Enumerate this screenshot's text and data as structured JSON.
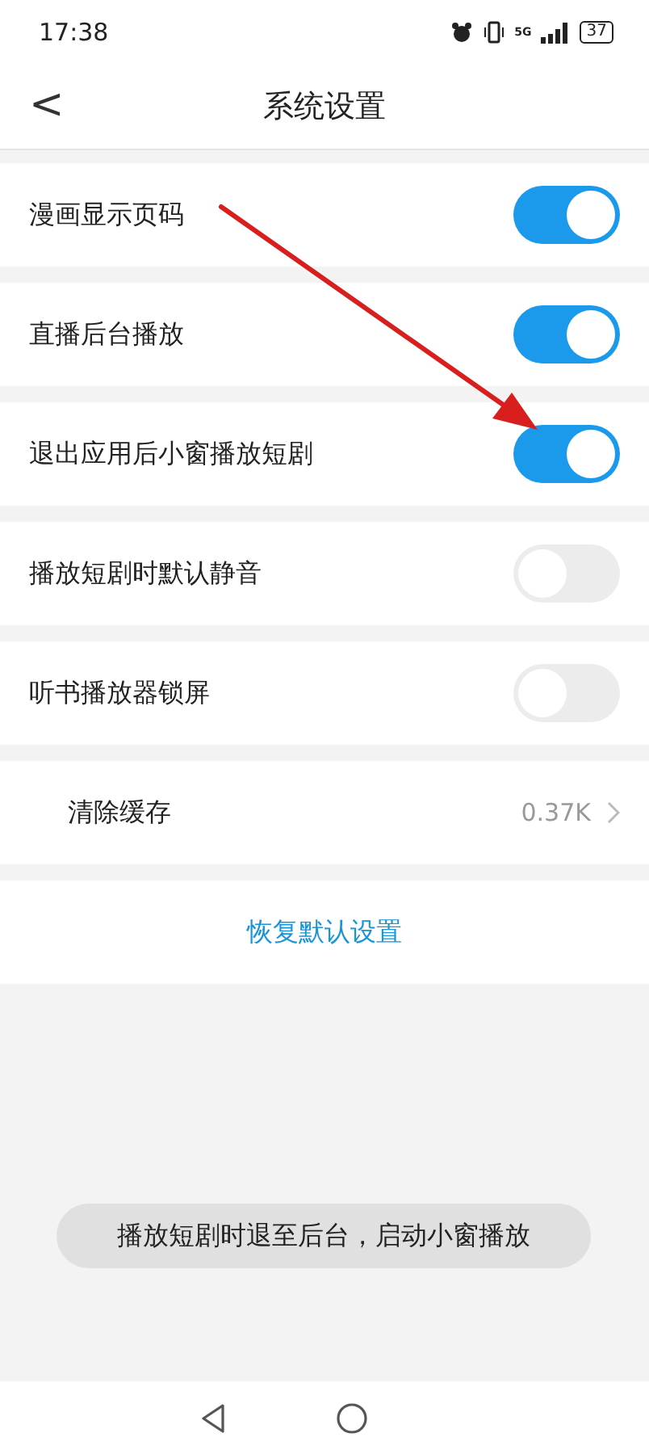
{
  "status_bar": {
    "time": "17:38",
    "battery": "37",
    "network": "5G"
  },
  "header": {
    "title": "系统设置",
    "back": "<"
  },
  "settings": [
    {
      "kind": "toggle",
      "label": "漫画显示页码",
      "on": true
    },
    {
      "kind": "toggle",
      "label": "直播后台播放",
      "on": true
    },
    {
      "kind": "toggle",
      "label": "退出应用后小窗播放短剧",
      "on": true
    },
    {
      "kind": "toggle",
      "label": "播放短剧时默认静音",
      "on": false
    },
    {
      "kind": "toggle",
      "label": "听书播放器锁屏",
      "on": false
    },
    {
      "kind": "value",
      "label": "清除缓存",
      "value": "0.37K"
    },
    {
      "kind": "action",
      "label": "恢复默认设置"
    }
  ],
  "toast": "播放短剧时退至后台，启动小窗播放"
}
